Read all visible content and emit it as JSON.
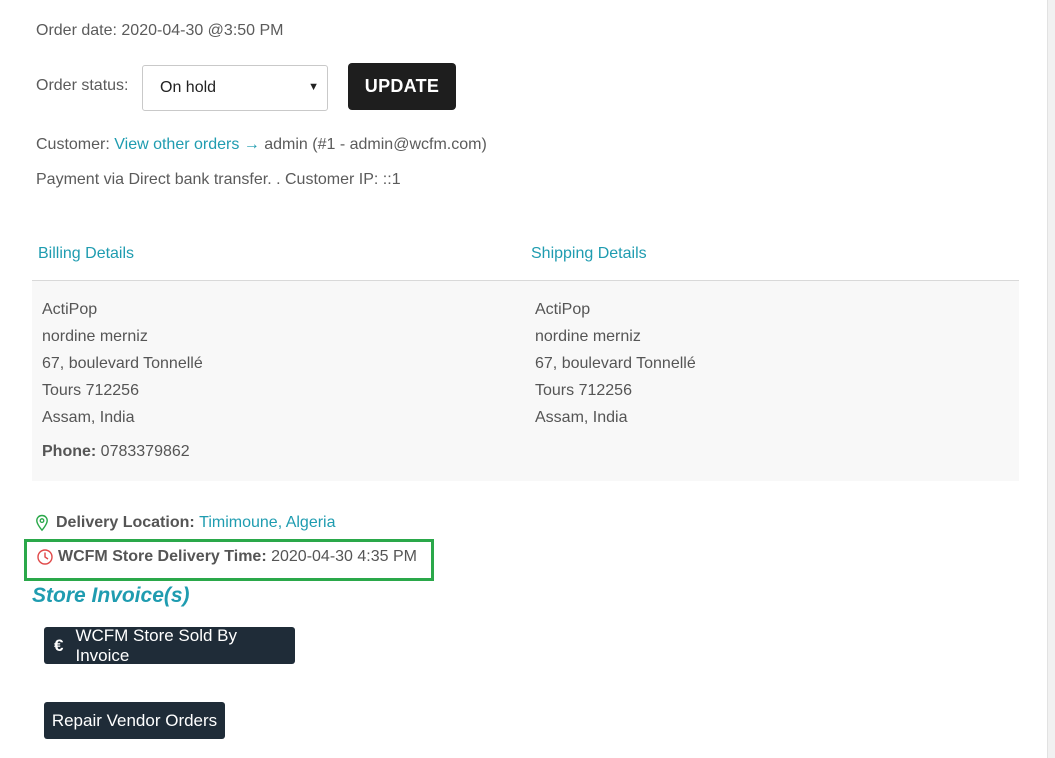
{
  "order": {
    "date_label": "Order date:",
    "date_value": "2020-04-30 @3:50 PM",
    "status_label": "Order status:",
    "status_value": "On hold",
    "update_label": "UPDATE"
  },
  "customer": {
    "label": "Customer:",
    "link": "View other orders →",
    "value": "admin (#1 - admin@wcfm.com)"
  },
  "payment": "Payment via Direct bank transfer. . Customer IP: ::1",
  "billing": {
    "title": "Billing Details",
    "lines": [
      "ActiPop",
      "nordine merniz",
      "67, boulevard Tonnellé",
      "Tours 712256",
      "Assam, India"
    ],
    "phone_label": "Phone:",
    "phone_value": "0783379862"
  },
  "shipping": {
    "title": "Shipping Details",
    "lines": [
      "ActiPop",
      "nordine merniz",
      "67, boulevard Tonnellé",
      "Tours 712256",
      "Assam, India"
    ]
  },
  "delivery": {
    "location_label": "Delivery Location:",
    "location_value": "Timimoune, Algeria",
    "location_icon": "map-pin-icon",
    "time_label": "WCFM Store Delivery Time:",
    "time_value": "2020-04-30 4:35 PM",
    "time_icon": "clock-icon",
    "highlight_color": "#2aa84a"
  },
  "invoices": {
    "title": "Store Invoice(s)",
    "invoice_icon": "€",
    "invoice_button": "WCFM Store Sold By Invoice",
    "repair_button": "Repair Vendor Orders"
  },
  "colors": {
    "accent": "#1f9cb0",
    "button_dark": "#1f2c38",
    "update_button": "#1e1e1e"
  }
}
